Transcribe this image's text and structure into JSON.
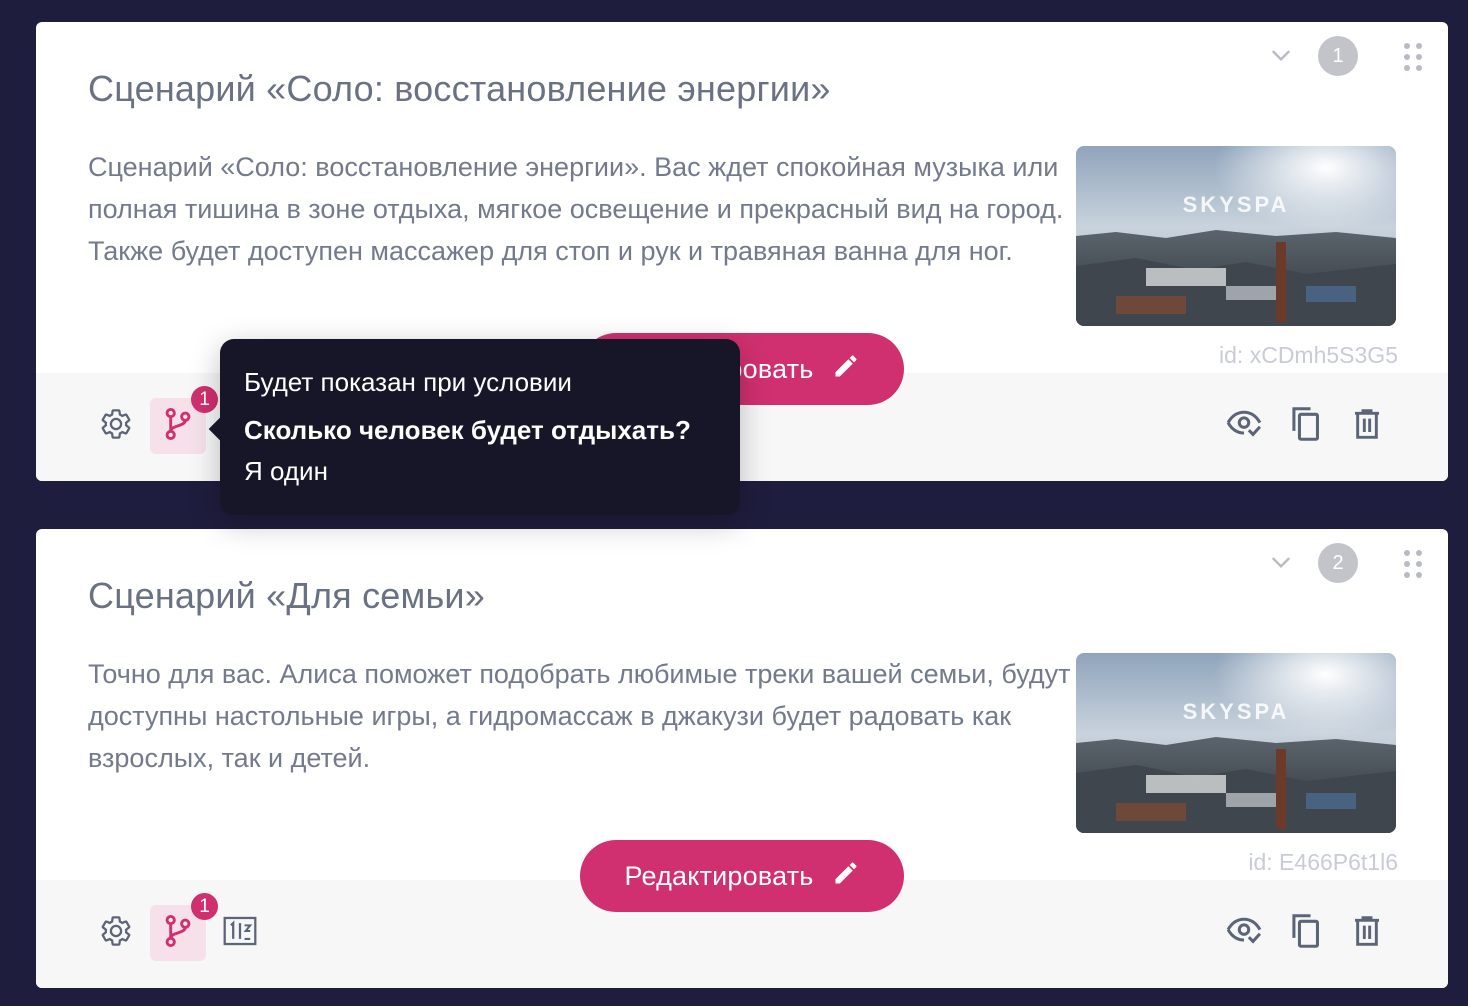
{
  "colors": {
    "background": "#1f1d3d",
    "accent": "#d0306f",
    "tooltip_bg": "#171528",
    "text": "#737a8c"
  },
  "cards": [
    {
      "number": "1",
      "title": "Сценарий «Соло: восстановление энергии»",
      "description": "Сценарий «Соло: восстановление энергии». Вас ждет спокойная музыка или полная тишина в зоне отдыха, мягкое освещение и прекрасный вид на город. Также будет доступен массажер для стоп и рук и травяная ванна для ног.",
      "image_watermark": "SKYSPA",
      "id_label": "id: xCDmh5S3G5",
      "edit_label": "Редактировать",
      "branch_badge": "1",
      "icons": [
        "settings-icon",
        "branch-icon",
        "eye-check-icon",
        "copy-icon",
        "trash-icon",
        "chevron-down-icon",
        "drag-handle-icon",
        "pencil-icon"
      ]
    },
    {
      "number": "2",
      "title": "Сценарий «Для семьи»",
      "description": "Точно для вас. Алиса поможет подобрать любимые треки вашей семьи, будут доступны настольные игры, а гидромассаж в джакузи будет радовать как взрослых, так и детей.",
      "image_watermark": "SKYSPA",
      "id_label": "id: E466P6t1l6",
      "edit_label": "Редактировать",
      "branch_badge": "1",
      "icons": [
        "settings-icon",
        "branch-icon",
        "number-block-icon",
        "eye-check-icon",
        "copy-icon",
        "trash-icon",
        "chevron-down-icon",
        "drag-handle-icon",
        "pencil-icon"
      ]
    }
  ],
  "tooltip": {
    "heading": "Будет показан при условии",
    "question": "Сколько человек будет отдыхать?",
    "answer": "Я один"
  }
}
